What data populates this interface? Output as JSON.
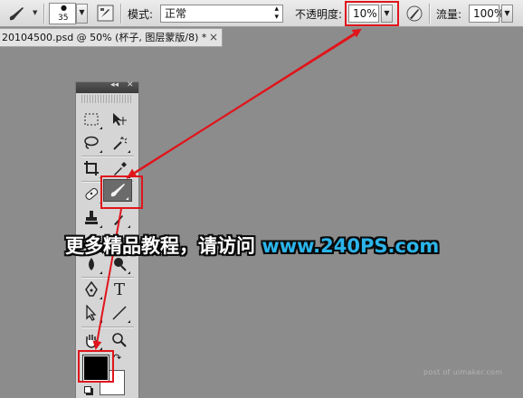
{
  "options_bar": {
    "brush_size": "35",
    "mode_label": "模式:",
    "mode_value": "正常",
    "opacity_label": "不透明度:",
    "opacity_value": "10%",
    "flow_label": "流量:",
    "flow_value": "100%"
  },
  "document_tab": {
    "title": "20104500.psd @ 50% (杯子, 图层蒙版/8) *",
    "close": "×"
  },
  "tools_panel": {
    "collapse": "◂◂",
    "close": "✕",
    "type_tool": "T"
  },
  "banner": {
    "text": "更多精品教程，请访问 ",
    "url": "www.240PS.com"
  },
  "watermark": "post of uimaker.com",
  "colors": {
    "highlight": "#e0151b",
    "banner_url": "#2bb4ea",
    "foreground_color": "#000000",
    "background_color": "#ffffff"
  }
}
